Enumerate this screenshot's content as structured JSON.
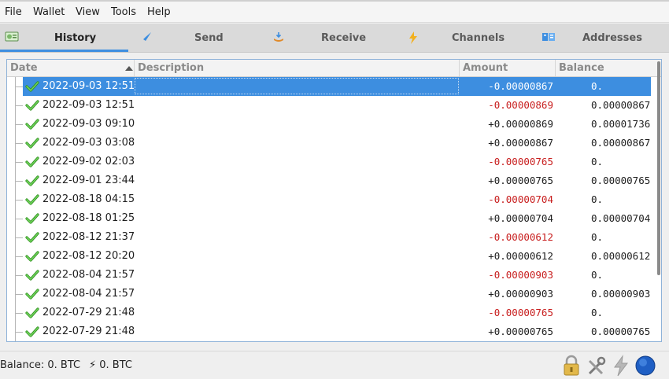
{
  "menu": {
    "items": [
      "File",
      "Wallet",
      "View",
      "Tools",
      "Help"
    ]
  },
  "tabs": [
    {
      "label": "History",
      "icon": "history-icon",
      "active": true
    },
    {
      "label": "Send",
      "icon": "send-icon",
      "active": false
    },
    {
      "label": "Receive",
      "icon": "receive-icon",
      "active": false
    },
    {
      "label": "Channels",
      "icon": "lightning-icon",
      "active": false
    },
    {
      "label": "Addresses",
      "icon": "addresses-icon",
      "active": false
    }
  ],
  "table": {
    "columns": [
      "Date",
      "Description",
      "Amount",
      "Balance"
    ],
    "sort_column": "Date",
    "rows": [
      {
        "date": "2022-09-03 12:51",
        "description": "",
        "amount": "-0.00000867",
        "balance": "0.",
        "negative": true,
        "selected": true
      },
      {
        "date": "2022-09-03 12:51",
        "description": "",
        "amount": "-0.00000869",
        "balance": "0.00000867",
        "negative": true,
        "selected": false
      },
      {
        "date": "2022-09-03 09:10",
        "description": "",
        "amount": "+0.00000869",
        "balance": "0.00001736",
        "negative": false,
        "selected": false
      },
      {
        "date": "2022-09-03 03:08",
        "description": "",
        "amount": "+0.00000867",
        "balance": "0.00000867",
        "negative": false,
        "selected": false
      },
      {
        "date": "2022-09-02 02:03",
        "description": "",
        "amount": "-0.00000765",
        "balance": "0.",
        "negative": true,
        "selected": false
      },
      {
        "date": "2022-09-01 23:44",
        "description": "",
        "amount": "+0.00000765",
        "balance": "0.00000765",
        "negative": false,
        "selected": false
      },
      {
        "date": "2022-08-18 04:15",
        "description": "",
        "amount": "-0.00000704",
        "balance": "0.",
        "negative": true,
        "selected": false
      },
      {
        "date": "2022-08-18 01:25",
        "description": "",
        "amount": "+0.00000704",
        "balance": "0.00000704",
        "negative": false,
        "selected": false
      },
      {
        "date": "2022-08-12 21:37",
        "description": "",
        "amount": "-0.00000612",
        "balance": "0.",
        "negative": true,
        "selected": false
      },
      {
        "date": "2022-08-12 20:20",
        "description": "",
        "amount": "+0.00000612",
        "balance": "0.00000612",
        "negative": false,
        "selected": false
      },
      {
        "date": "2022-08-04 21:57",
        "description": "",
        "amount": "-0.00000903",
        "balance": "0.",
        "negative": true,
        "selected": false
      },
      {
        "date": "2022-08-04 21:57",
        "description": "",
        "amount": "+0.00000903",
        "balance": "0.00000903",
        "negative": false,
        "selected": false
      },
      {
        "date": "2022-07-29 21:48",
        "description": "",
        "amount": "-0.00000765",
        "balance": "0.",
        "negative": true,
        "selected": false
      },
      {
        "date": "2022-07-29 21:48",
        "description": "",
        "amount": "+0.00000765",
        "balance": "0.00000765",
        "negative": false,
        "selected": false
      }
    ]
  },
  "status": {
    "balance": "Balance: 0. BTC",
    "lightning": "⚡ 0. BTC",
    "icons": [
      "lock-icon",
      "preferences-icon",
      "lightning-network-icon",
      "network-status-icon"
    ]
  },
  "colors": {
    "accent": "#3d8ee0",
    "negative": "#c81e1e",
    "confirmed": "#3fae2a"
  }
}
